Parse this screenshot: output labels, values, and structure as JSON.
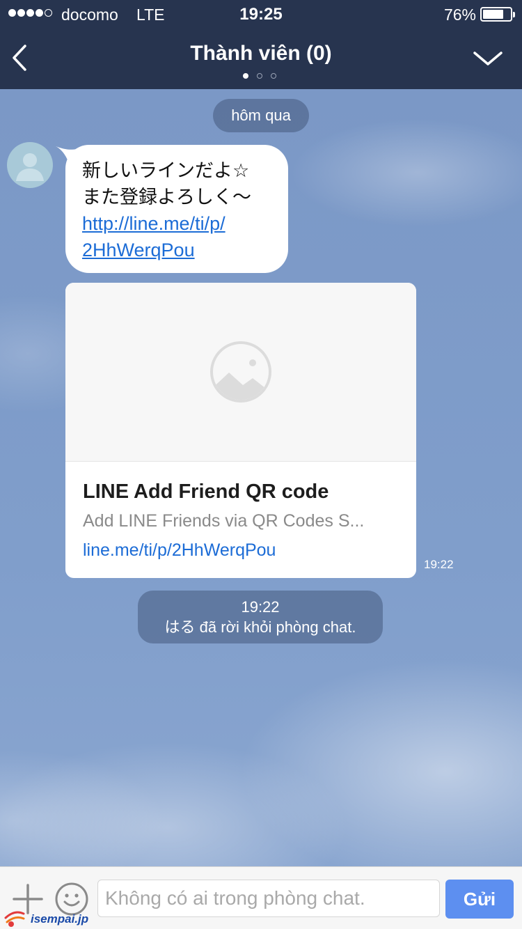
{
  "status_bar": {
    "signal_bars_filled": 4,
    "signal_bars_total": 5,
    "carrier": "docomo",
    "network": "LTE",
    "time": "19:25",
    "battery_percent": "76%",
    "battery_level": 0.76
  },
  "header": {
    "title": "Thành viên (0)",
    "page_indicator": {
      "count": 3,
      "active": 0
    },
    "back_icon": "chevron-left-icon",
    "menu_icon": "chevron-down-icon"
  },
  "chat": {
    "date_divider": "hôm qua",
    "message": {
      "text_lines": [
        "新しいラインだよ☆",
        "また登録よろしく〜"
      ],
      "link_lines": [
        "http://line.me/ti/p/",
        "2HhWerqPou"
      ],
      "link_preview": {
        "image_icon": "image-placeholder-icon",
        "title": "LINE Add Friend QR code",
        "description": "Add LINE Friends via QR Codes S...",
        "url": "line.me/ti/p/2HhWerqPou"
      },
      "time": "19:22"
    },
    "system_notice": {
      "time": "19:22",
      "text": "はる đã rời khỏi phòng chat."
    }
  },
  "input_bar": {
    "placeholder": "Không có ai trong phòng chat.",
    "send_label": "Gửi",
    "plus_icon": "plus-icon",
    "emoji_icon": "emoji-icon"
  },
  "watermark": {
    "text": "isempai.jp"
  },
  "colors": {
    "header_bg": "#27344f",
    "link": "#1c6cd6",
    "send_button": "#5d8ff0"
  }
}
